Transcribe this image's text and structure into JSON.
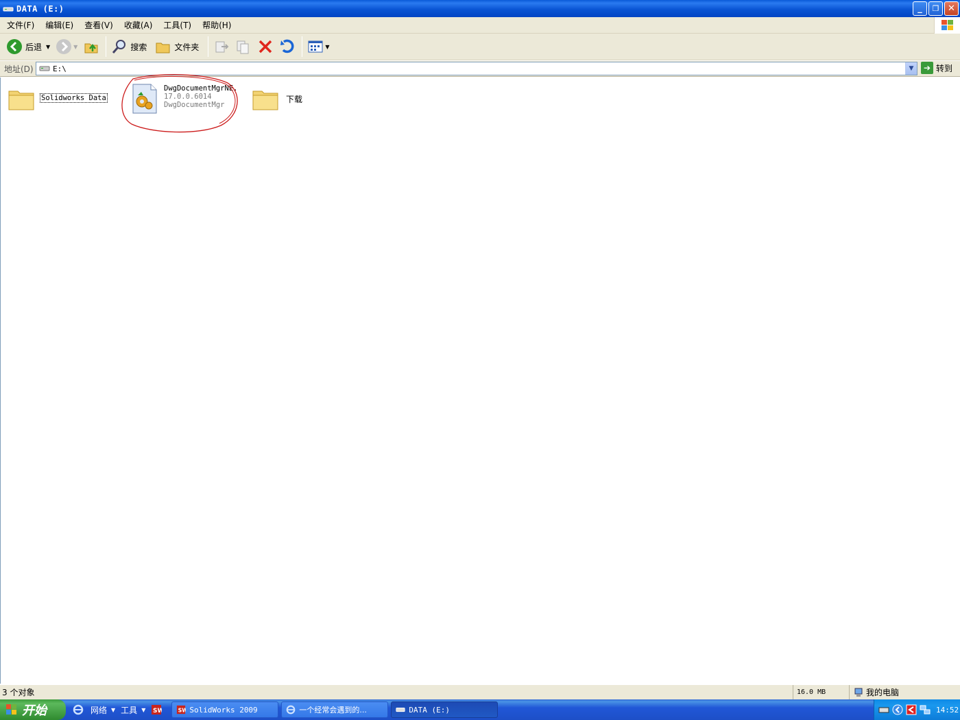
{
  "window": {
    "title": "DATA (E:)"
  },
  "menu": {
    "items": [
      "文件(F)",
      "编辑(E)",
      "查看(V)",
      "收藏(A)",
      "工具(T)",
      "帮助(H)"
    ]
  },
  "toolbar": {
    "back_label": "后退",
    "search_label": "搜索",
    "folders_label": "文件夹"
  },
  "address": {
    "label": "地址(D)",
    "value": "E:\\",
    "go_label": "转到"
  },
  "files": [
    {
      "name": "Solidworks Data",
      "type": "folder"
    },
    {
      "name": "DwgDocumentMgrNE.",
      "version": "17.0.0.6014",
      "description": "DwgDocumentMgr",
      "type": "file"
    },
    {
      "name": "下载",
      "type": "folder"
    }
  ],
  "status": {
    "objects": "3 个对象",
    "size": "16.0 MB",
    "location": "我的电脑"
  },
  "taskbar": {
    "start_label": "开始",
    "quicklaunch": [
      "网络",
      "工具"
    ],
    "tasks": [
      "SolidWorks 2009",
      "一个经常会遇到的...",
      "DATA (E:)"
    ],
    "clock": "14:52"
  },
  "colors": {
    "annotation_circle": "#cc1a1a",
    "titlebar": "#0a55d4",
    "start_button": "#3c9c3c"
  }
}
